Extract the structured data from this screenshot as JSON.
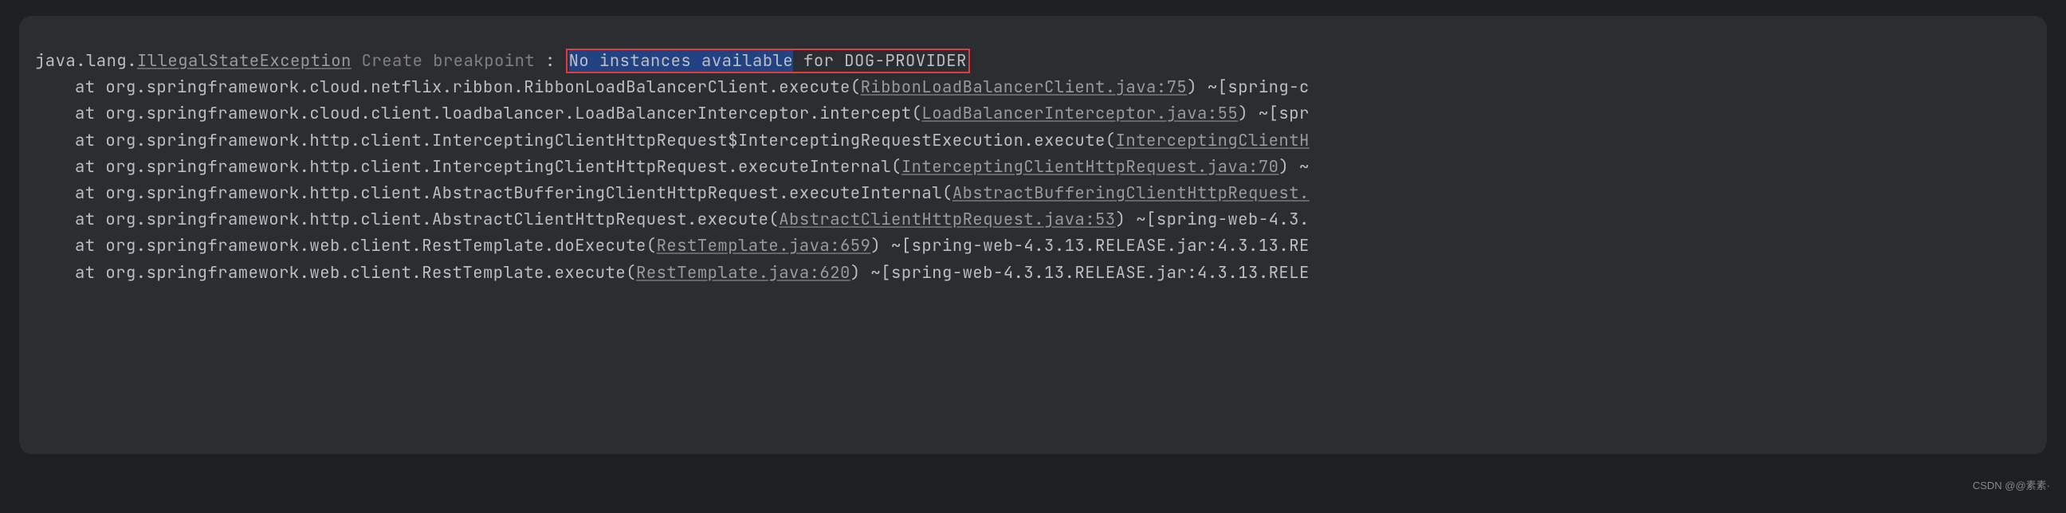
{
  "exception": {
    "pkg": "java.lang.",
    "class": "IllegalStateException",
    "breakpoint_hint": " Create breakpoint",
    "colon": " : ",
    "highlighted": "No instances available",
    "rest": " for DOG-PROVIDER"
  },
  "frames": [
    {
      "at": "at ",
      "method": "org.springframework.cloud.netflix.ribbon.RibbonLoadBalancerClient.execute(",
      "source": "RibbonLoadBalancerClient.java:75",
      "tail": ") ~[spring-c"
    },
    {
      "at": "at ",
      "method": "org.springframework.cloud.client.loadbalancer.LoadBalancerInterceptor.intercept(",
      "source": "LoadBalancerInterceptor.java:55",
      "tail": ") ~[spr"
    },
    {
      "at": "at ",
      "method": "org.springframework.http.client.InterceptingClientHttpRequest$InterceptingRequestExecution.execute(",
      "source": "InterceptingClientH",
      "tail": ""
    },
    {
      "at": "at ",
      "method": "org.springframework.http.client.InterceptingClientHttpRequest.executeInternal(",
      "source": "InterceptingClientHttpRequest.java:70",
      "tail": ") ~"
    },
    {
      "at": "at ",
      "method": "org.springframework.http.client.AbstractBufferingClientHttpRequest.executeInternal(",
      "source": "AbstractBufferingClientHttpRequest.",
      "tail": ""
    },
    {
      "at": "at ",
      "method": "org.springframework.http.client.AbstractClientHttpRequest.execute(",
      "source": "AbstractClientHttpRequest.java:53",
      "tail": ") ~[spring-web-4.3."
    },
    {
      "at": "at ",
      "method": "org.springframework.web.client.RestTemplate.doExecute(",
      "source": "RestTemplate.java:659",
      "tail": ") ~[spring-web-4.3.13.RELEASE.jar:4.3.13.RE"
    },
    {
      "at": "at ",
      "method": "org.springframework.web.client.RestTemplate.execute(",
      "source": "RestTemplate.java:620",
      "tail": ") ~[spring-web-4.3.13.RELEASE.jar:4.3.13.RELE"
    }
  ],
  "watermark": "CSDN @@素素·"
}
